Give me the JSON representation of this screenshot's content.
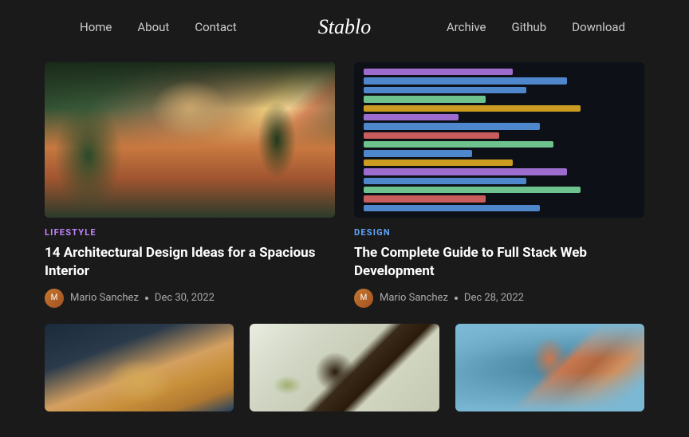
{
  "header": {
    "logo": "Stablo",
    "nav_left": [
      {
        "label": "Home",
        "id": "home"
      },
      {
        "label": "About",
        "id": "about"
      },
      {
        "label": "Contact",
        "id": "contact"
      }
    ],
    "nav_right": [
      {
        "label": "Archive",
        "id": "archive"
      },
      {
        "label": "Github",
        "id": "github"
      },
      {
        "label": "Download",
        "id": "download"
      }
    ]
  },
  "top_cards": [
    {
      "category": "LIFESTYLE",
      "category_class": "category-lifestyle",
      "title": "14 Architectural Design Ideas for a Spacious Interior",
      "author": "Mario Sanchez",
      "date": "Dec 30, 2022",
      "image_type": "interior"
    },
    {
      "category": "DESIGN",
      "category_class": "category-design",
      "title": "The Complete Guide to Full Stack Web Development",
      "author": "Mario Sanchez",
      "date": "Dec 28, 2022",
      "image_type": "code"
    }
  ],
  "bottom_cards": [
    {
      "image_type": "food"
    },
    {
      "image_type": "coffee"
    },
    {
      "image_type": "portrait"
    }
  ],
  "code_lines": [
    {
      "color": "#c084fc",
      "width": "55%"
    },
    {
      "color": "#60a5fa",
      "width": "75%"
    },
    {
      "color": "#60a5fa",
      "width": "60%"
    },
    {
      "color": "#86efac",
      "width": "45%"
    },
    {
      "color": "#fbbf24",
      "width": "80%"
    },
    {
      "color": "#c084fc",
      "width": "35%"
    },
    {
      "color": "#60a5fa",
      "width": "65%"
    },
    {
      "color": "#f87171",
      "width": "50%"
    },
    {
      "color": "#86efac",
      "width": "70%"
    },
    {
      "color": "#60a5fa",
      "width": "40%"
    },
    {
      "color": "#fbbf24",
      "width": "55%"
    },
    {
      "color": "#c084fc",
      "width": "75%"
    },
    {
      "color": "#60a5fa",
      "width": "60%"
    },
    {
      "color": "#86efac",
      "width": "80%"
    },
    {
      "color": "#f87171",
      "width": "45%"
    },
    {
      "color": "#60a5fa",
      "width": "65%"
    }
  ]
}
